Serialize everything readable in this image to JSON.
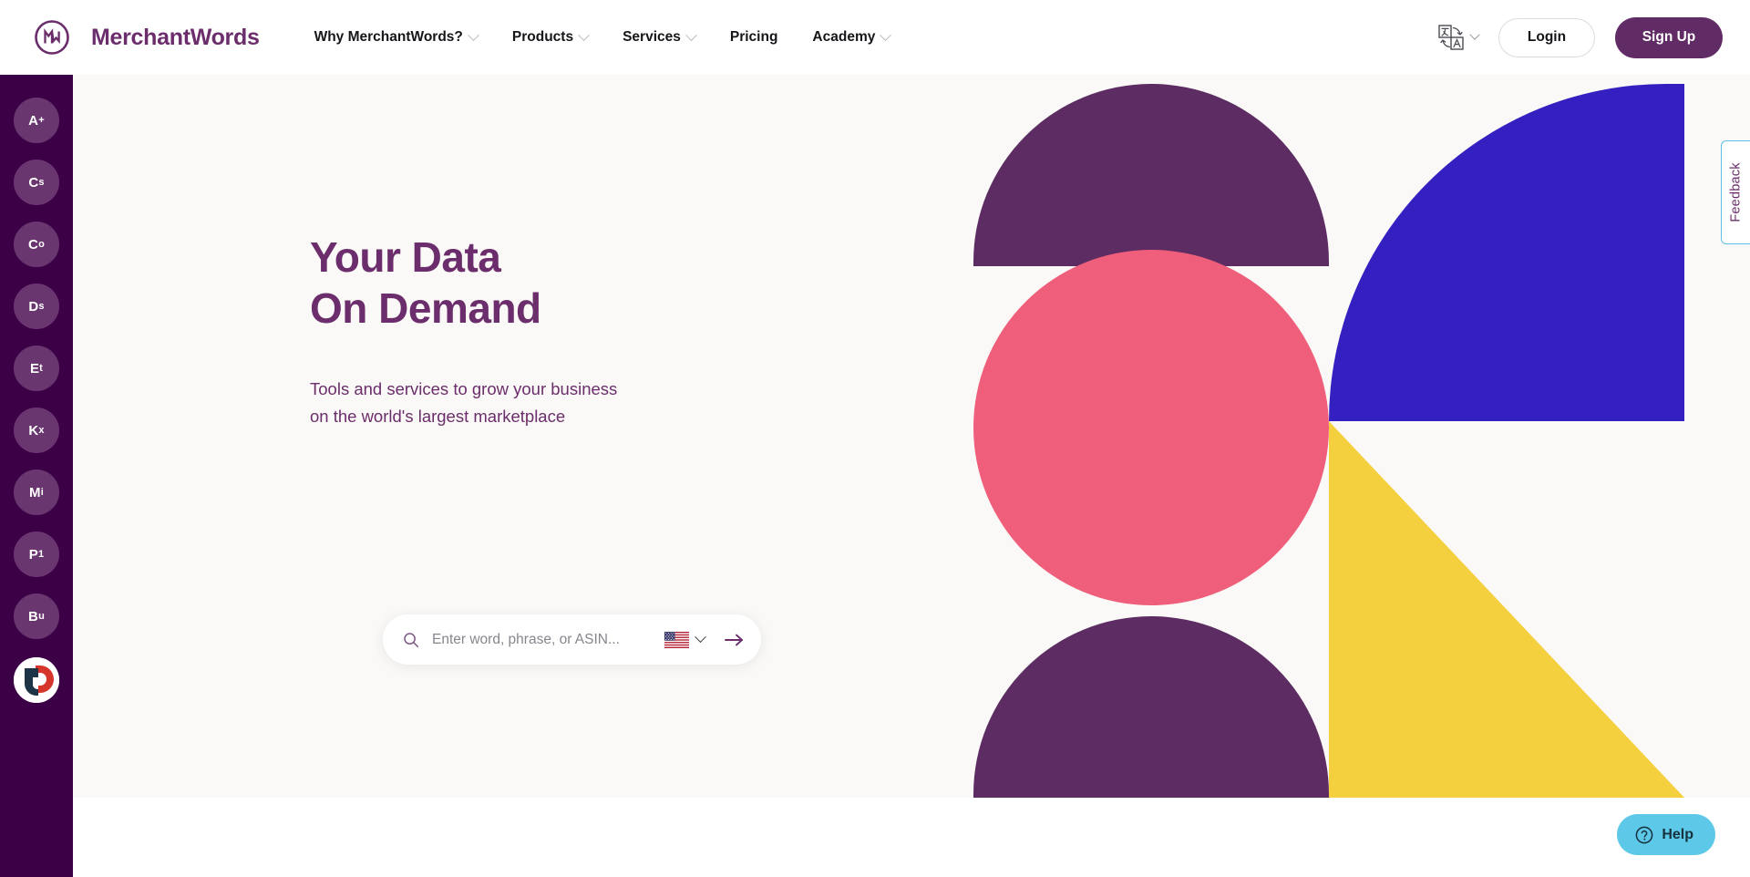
{
  "header": {
    "logo_word": "MerchantWords",
    "logo_icon": "merchantwords-monogram-icon",
    "nav": [
      {
        "label": "Why MerchantWords?",
        "has_dropdown": true
      },
      {
        "label": "Products",
        "has_dropdown": true
      },
      {
        "label": "Services",
        "has_dropdown": true
      },
      {
        "label": "Pricing",
        "has_dropdown": false
      },
      {
        "label": "Academy",
        "has_dropdown": true
      }
    ],
    "translate_icon": "translate-icon",
    "login_label": "Login",
    "signup_label": "Sign Up"
  },
  "sidebar": {
    "background": "#3c0046",
    "badge_color": "#6a3670",
    "items": [
      {
        "label": "A+",
        "main": "A",
        "sub": "+"
      },
      {
        "label": "Cs",
        "main": "C",
        "sub": "s"
      },
      {
        "label": "Co",
        "main": "C",
        "sub": "o"
      },
      {
        "label": "Ds",
        "main": "D",
        "sub": "s"
      },
      {
        "label": "Et",
        "main": "E",
        "sub": "t"
      },
      {
        "label": "Kx",
        "main": "K",
        "sub": "x"
      },
      {
        "label": "Mi",
        "main": "M",
        "sub": "i"
      },
      {
        "label": "P1",
        "main": "P",
        "sub": "1"
      },
      {
        "label": "Bu",
        "main": "B",
        "sub": "u"
      }
    ],
    "footer_logo_icon": "partner-logo-icon"
  },
  "hero": {
    "background": "#faf9f7",
    "title": "Your Data\nOn Demand",
    "subtitle": "Tools and services to grow your business\non the world's largest marketplace",
    "title_color": "#6b2d6b",
    "search": {
      "placeholder": "Enter word, phrase, or ASIN...",
      "value": "",
      "search_icon": "search-icon",
      "flag": "us-flag-icon",
      "chevron": "chevron-down-icon",
      "submit_icon": "arrow-right-icon"
    },
    "shapes": [
      {
        "name": "dome-purple-top",
        "color": "#5c2c63"
      },
      {
        "name": "circle-pink",
        "color": "#ef5f7c"
      },
      {
        "name": "dome-purple-bottom",
        "color": "#5c2c63"
      },
      {
        "name": "quarter-circle-blue",
        "color": "#3420c0"
      },
      {
        "name": "triangle-yellow",
        "color": "#f4d03f"
      }
    ]
  },
  "feedback": {
    "label": "Feedback",
    "border_color": "#5ec0e4",
    "text_color": "#6b2d6b"
  },
  "help": {
    "label": "Help",
    "icon": "question-mark-icon",
    "background": "#5ec8e8"
  }
}
